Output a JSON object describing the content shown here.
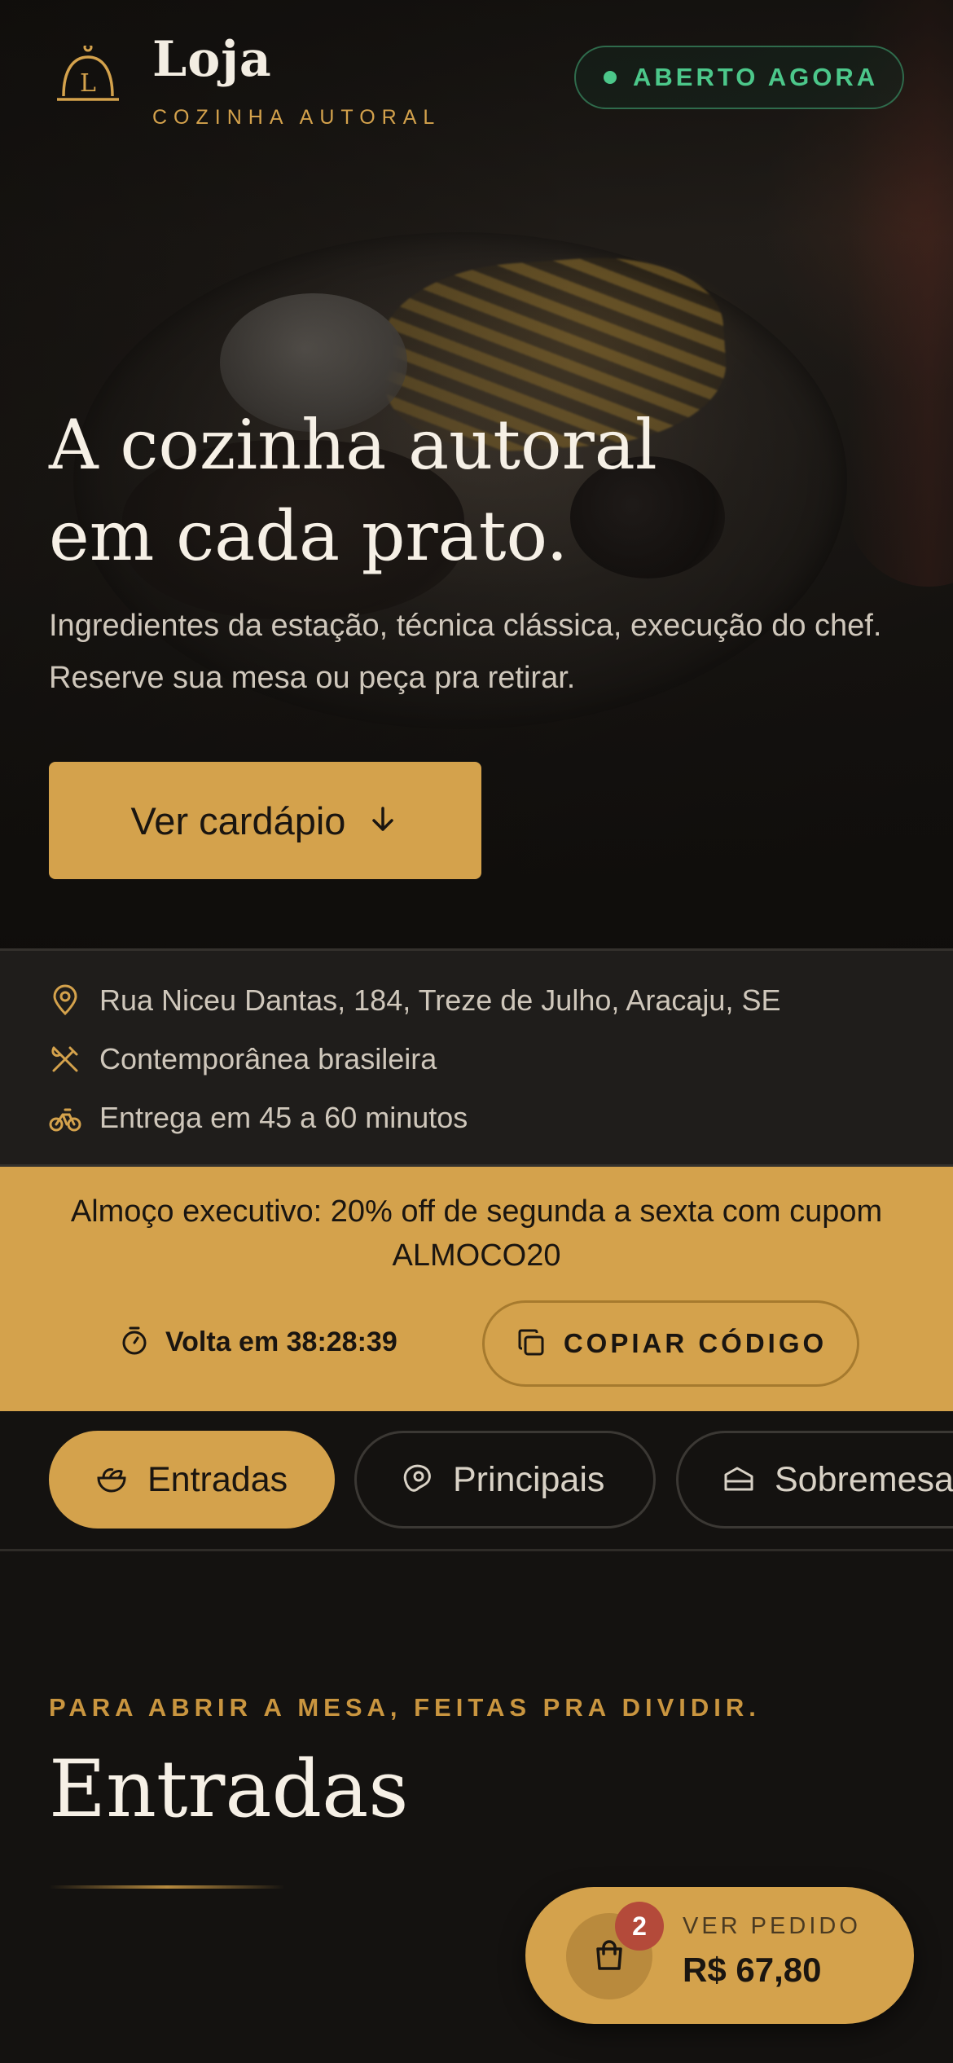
{
  "header": {
    "brand_name": "Loja",
    "brand_sub": "COZINHA AUTORAL",
    "logo_letter": "L",
    "status": "ABERTO AGORA"
  },
  "hero": {
    "title_line1": "A cozinha autoral",
    "title_line2": "em cada prato.",
    "text": "Ingredientes da estação, técnica clássica, execução do chef. Reserve sua mesa ou peça pra retirar.",
    "cta_label": "Ver cardápio"
  },
  "info": {
    "address": "Rua Niceu Dantas, 184, Treze de Julho, Aracaju, SE",
    "cuisine": "Contemporânea brasileira",
    "delivery": "Entrega em 45 a 60 minutos"
  },
  "promo": {
    "text": "Almoço executivo: 20% off de segunda a sexta com cupom ALMOCO20",
    "timer": "Volta em 38:28:39",
    "copy_label": "COPIAR CÓDIGO"
  },
  "tabs": [
    {
      "label": "Entradas",
      "icon": "salad-icon",
      "active": true
    },
    {
      "label": "Principais",
      "icon": "steak-icon",
      "active": false
    },
    {
      "label": "Sobremesas",
      "icon": "cake-icon",
      "active": false
    }
  ],
  "section": {
    "eyebrow": "PARA ABRIR A MESA, FEITAS PRA DIVIDIR.",
    "title": "Entradas"
  },
  "cart": {
    "count": "2",
    "label": "VER PEDIDO",
    "total": "R$ 67,80"
  },
  "colors": {
    "accent": "#d4a24c",
    "background": "#141210",
    "status_green": "#4cc78a",
    "badge_red": "#b44a3a"
  }
}
